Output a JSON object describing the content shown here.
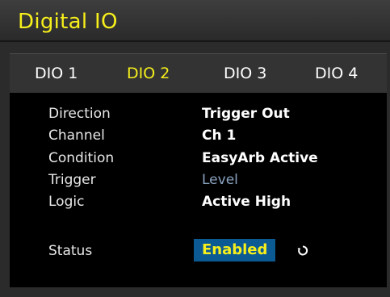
{
  "header": {
    "title": "Digital IO"
  },
  "tabs": [
    {
      "label": "DIO 1"
    },
    {
      "label": "DIO 2"
    },
    {
      "label": "DIO 3"
    },
    {
      "label": "DIO 4"
    }
  ],
  "active_tab": "DIO 2",
  "settings": {
    "direction": {
      "label": "Direction",
      "value": "Trigger Out"
    },
    "channel": {
      "label": "Channel",
      "value": "Ch 1"
    },
    "condition": {
      "label": "Condition",
      "value": "EasyArb Active"
    },
    "trigger": {
      "label": "Trigger",
      "value": "Level"
    },
    "logic": {
      "label": "Logic",
      "value": "Active High"
    },
    "status": {
      "label": "Status",
      "value": "Enabled"
    }
  },
  "icons": {
    "status_cycle": "cycle-icon"
  },
  "colors": {
    "accent_yellow": "#f6ef1b",
    "selection_blue": "#0b5a93",
    "disabled_text": "#8aa3bf",
    "background": "#000000"
  }
}
